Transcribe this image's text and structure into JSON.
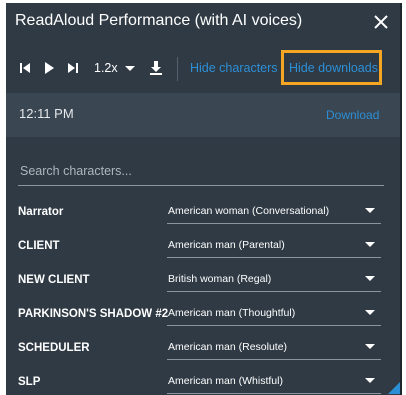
{
  "window": {
    "title": "ReadAloud Performance (with AI voices)",
    "close_icon": "close-icon"
  },
  "toolbar": {
    "speed": "1.2x",
    "hide_characters": "Hide characters",
    "hide_downloads": "Hide downloads",
    "icons": [
      "skip-back-icon",
      "play-icon",
      "skip-forward-icon",
      "chevron-down-icon",
      "download-icon"
    ]
  },
  "downloads": {
    "time": "12:11 PM",
    "download_label": "Download"
  },
  "search": {
    "placeholder": "Search characters..."
  },
  "characters": [
    {
      "name": "Narrator",
      "voice": "American woman (Conversational)"
    },
    {
      "name": "CLIENT",
      "voice": "American man (Parental)"
    },
    {
      "name": "NEW CLIENT",
      "voice": "British woman (Regal)"
    },
    {
      "name": "PARKINSON'S SHADOW #2",
      "voice": "American man (Thoughtful)"
    },
    {
      "name": "SCHEDULER",
      "voice": "American man (Resolute)"
    },
    {
      "name": "SLP",
      "voice": "American man (Whistful)"
    }
  ],
  "colors": {
    "panel_bg": "#2f3a44",
    "row_bg": "#3a4651",
    "link": "#2c8fd6",
    "highlight": "#f5a623"
  }
}
